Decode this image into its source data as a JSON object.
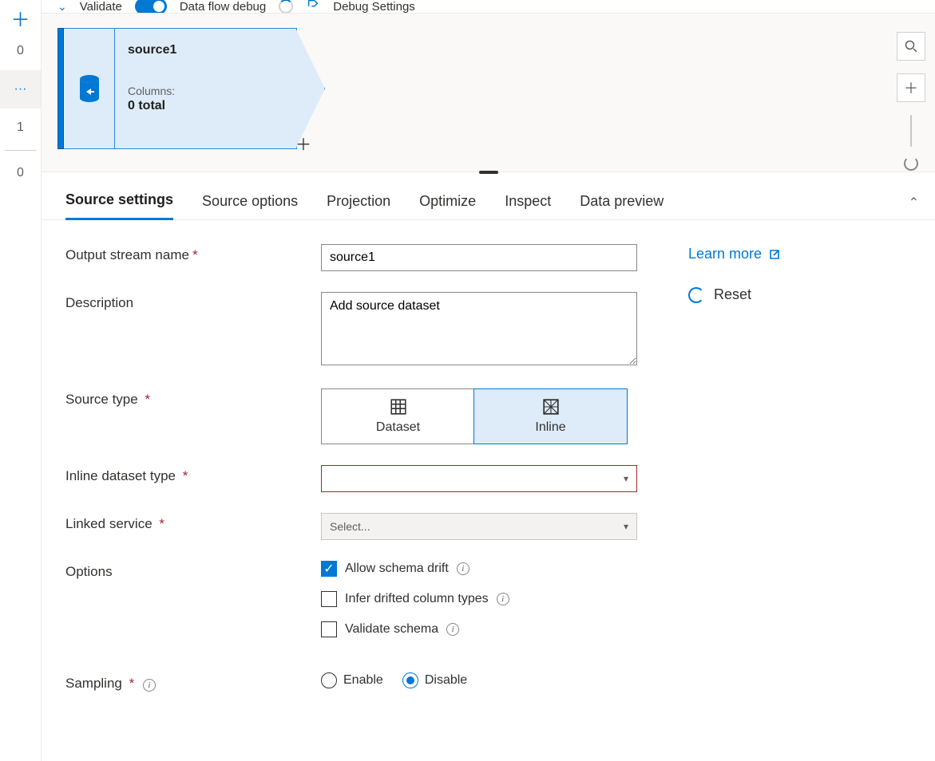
{
  "leftnav": {
    "items": [
      "0",
      "···",
      "1",
      "0"
    ],
    "selected_index": 1
  },
  "toolbar": {
    "validate": "Validate",
    "debug_label": "Data flow debug",
    "settings": "Debug Settings"
  },
  "canvas": {
    "node": {
      "title": "source1",
      "columns_label": "Columns:",
      "count": "0 total"
    }
  },
  "tabs": {
    "items": [
      "Source settings",
      "Source options",
      "Projection",
      "Optimize",
      "Inspect",
      "Data preview"
    ],
    "active_index": 0
  },
  "form": {
    "out_stream_label": "Output stream name",
    "out_stream_value": "source1",
    "description_label": "Description",
    "description_value": "Add source dataset",
    "source_type_label": "Source type",
    "source_type_options": {
      "dataset": "Dataset",
      "inline": "Inline"
    },
    "inline_type_label": "Inline dataset type",
    "linked_label": "Linked service",
    "linked_placeholder": "Select...",
    "options_label": "Options",
    "opt_drift": "Allow schema drift",
    "opt_infer": "Infer drifted column types",
    "opt_validate": "Validate schema",
    "sampling_label": "Sampling",
    "sampling_enable": "Enable",
    "sampling_disable": "Disable"
  },
  "side": {
    "learn_more": "Learn more",
    "reset": "Reset"
  }
}
